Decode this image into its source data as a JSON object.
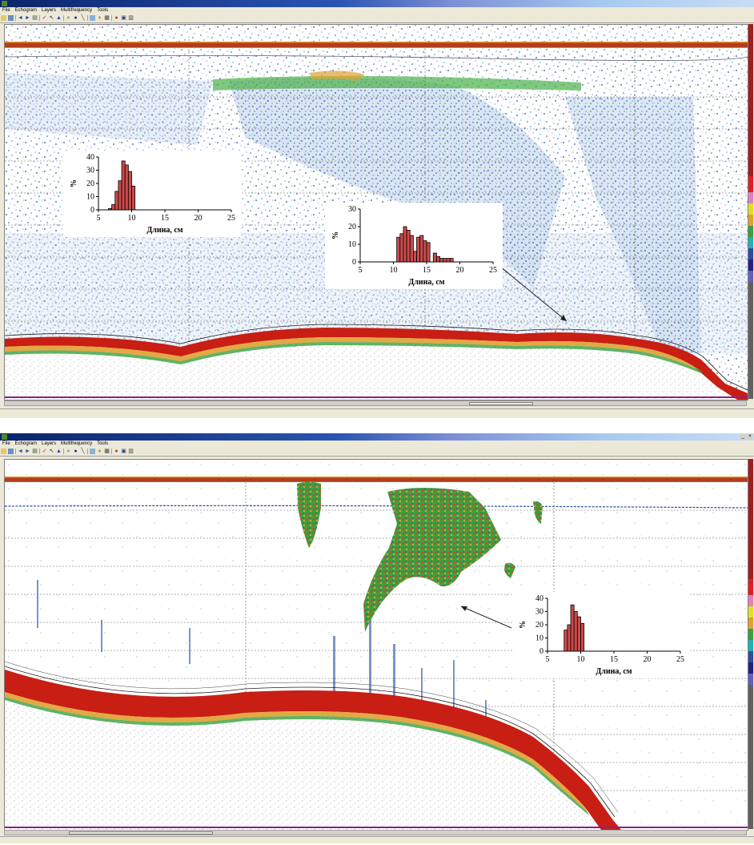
{
  "windows": [
    {
      "id": "w1",
      "title": "",
      "menu": [
        "File",
        "Echogram",
        "Layers",
        "Multifrequency",
        "Tools"
      ],
      "status": [],
      "timeline": [
        "",
        "",
        ""
      ],
      "colors": {
        "bottom": "#c81e14",
        "surface": "#b43c1e",
        "signal_blue": "#2a4ea0",
        "signal_green": "#3aa040"
      }
    },
    {
      "id": "w2",
      "title": "",
      "menu": [
        "File",
        "Echogram",
        "Layers",
        "Multifrequency",
        "Tools"
      ],
      "status": [],
      "timeline": [
        "",
        ""
      ],
      "colors": {
        "bottom": "#c81e14",
        "surface": "#b43c1e",
        "signal_blue": "#2a4ea0",
        "signal_green": "#3aa040"
      }
    }
  ],
  "chart_data": [
    {
      "id": "inset1",
      "type": "bar",
      "xlabel": "Длина, см",
      "ylabel": "%",
      "xlim": [
        5,
        25
      ],
      "ylim": [
        0,
        40
      ],
      "xticks": [
        5,
        10,
        15,
        20,
        25
      ],
      "yticks": [
        0,
        10,
        20,
        30,
        40
      ],
      "bar_width": 0.5,
      "x": [
        6.5,
        7.0,
        7.5,
        8.0,
        8.5,
        9.0,
        9.5,
        10.0
      ],
      "values": [
        1,
        4,
        14,
        22,
        37,
        34,
        29,
        18
      ],
      "color": "#cc4a4a"
    },
    {
      "id": "inset2",
      "type": "bar",
      "xlabel": "Длина, см",
      "ylabel": "%",
      "xlim": [
        5,
        25
      ],
      "ylim": [
        0,
        30
      ],
      "xticks": [
        5,
        10,
        15,
        20,
        25
      ],
      "yticks": [
        0,
        10,
        20,
        30
      ],
      "bar_width": 0.5,
      "x": [
        10,
        10.5,
        11,
        11.5,
        12,
        12.5,
        13,
        13.5,
        14,
        14.5,
        15,
        15.5,
        16,
        16.5,
        17,
        17.5,
        18,
        18.5,
        19,
        19.5,
        20,
        20.5,
        21,
        21.5
      ],
      "values": [
        0,
        14,
        16,
        20,
        18,
        15,
        6,
        14,
        15,
        12,
        11,
        0,
        5,
        3,
        2,
        2,
        2,
        2,
        0,
        0,
        0,
        0,
        0,
        0
      ],
      "color": "#cc4a4a"
    },
    {
      "id": "inset3",
      "type": "bar",
      "xlabel": "Длина, см",
      "ylabel": "%",
      "xlim": [
        5,
        25
      ],
      "ylim": [
        0,
        40
      ],
      "xticks": [
        5,
        10,
        15,
        20,
        25
      ],
      "yticks": [
        0,
        10,
        20,
        30,
        40
      ],
      "bar_width": 0.5,
      "x": [
        7.5,
        8.0,
        8.5,
        9.0,
        9.5,
        10.0,
        10.5,
        11.0,
        11.5
      ],
      "values": [
        16,
        20,
        35,
        30,
        26,
        21,
        0,
        0,
        0
      ],
      "color": "#cc4a4a"
    }
  ]
}
